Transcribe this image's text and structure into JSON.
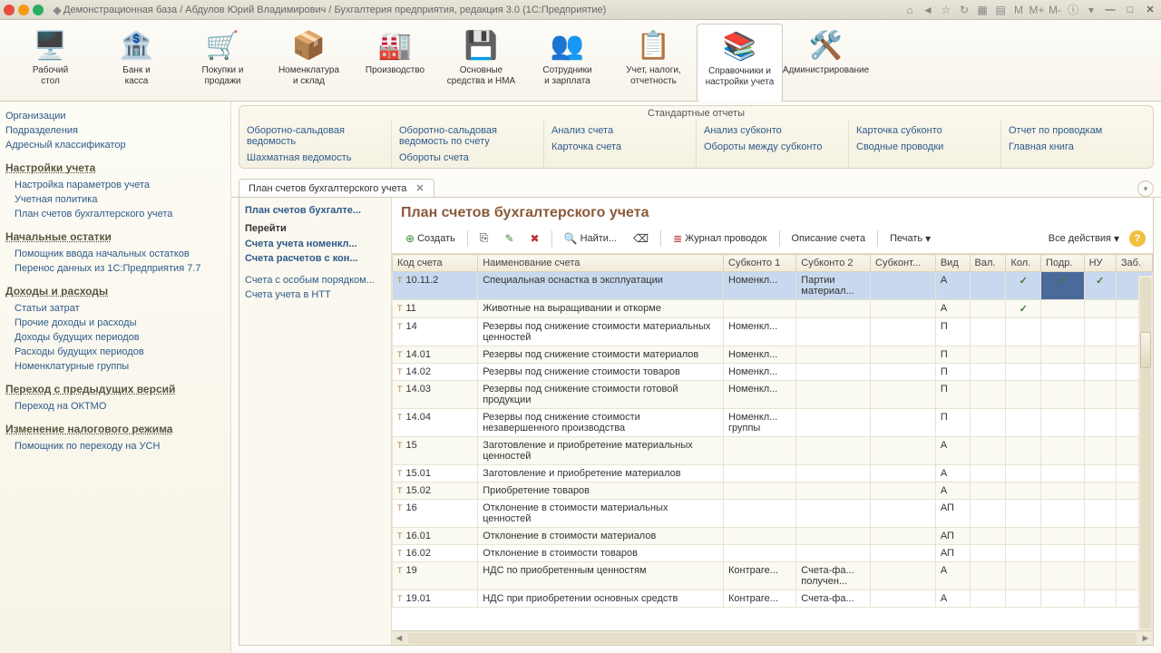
{
  "titlebar": {
    "text": "Демонстрационная база / Абдулов Юрий Владимирович / Бухгалтерия предприятия, редакция 3.0  (1С:Предприятие)",
    "m": "M",
    "mplus": "M+",
    "mminus": "M-"
  },
  "toolbar": [
    {
      "label": "Рабочий\nстол"
    },
    {
      "label": "Банк и\nкасса"
    },
    {
      "label": "Покупки и\nпродажи"
    },
    {
      "label": "Номенклатура\nи склад"
    },
    {
      "label": "Производство"
    },
    {
      "label": "Основные\nсредства и НМА"
    },
    {
      "label": "Сотрудники\nи зарплата"
    },
    {
      "label": "Учет, налоги,\nотчетность"
    },
    {
      "label": "Справочники и\nнастройки учета"
    },
    {
      "label": "Администрирование"
    }
  ],
  "sidebar": {
    "top": [
      "Организации",
      "Подразделения",
      "Адресный классификатор"
    ],
    "groups": [
      {
        "title": "Настройки учета",
        "items": [
          "Настройка параметров учета",
          "Учетная политика",
          "План счетов бухгалтерского учета"
        ]
      },
      {
        "title": "Начальные остатки",
        "items": [
          "Помощник ввода начальных остатков",
          "Перенос данных из 1С:Предприятия 7.7"
        ]
      },
      {
        "title": "Доходы и расходы",
        "items": [
          "Статьи затрат",
          "Прочие доходы и расходы",
          "Доходы будущих периодов",
          "Расходы будущих периодов",
          "Номенклатурные группы"
        ]
      },
      {
        "title": "Переход с предыдущих версий",
        "items": [
          "Переход на ОКТМО"
        ]
      },
      {
        "title": "Изменение налогового режима",
        "items": [
          "Помощник по переходу на УСН"
        ]
      }
    ]
  },
  "reports": {
    "title": "Стандартные отчеты",
    "cols": [
      [
        "Оборотно-сальдовая ведомость",
        "Шахматная ведомость"
      ],
      [
        "Оборотно-сальдовая ведомость по счету",
        "Обороты счета"
      ],
      [
        "Анализ счета",
        "Карточка счета"
      ],
      [
        "Анализ субконто",
        "Обороты между субконто"
      ],
      [
        "Карточка субконто",
        "Сводные проводки"
      ],
      [
        "Отчет по проводкам",
        "Главная книга"
      ]
    ]
  },
  "tab": {
    "label": "План счетов бухгалтерского учета"
  },
  "sub_sidebar": {
    "current": "План счетов бухгалте...",
    "go_title": "Перейти",
    "go_items": [
      "Счета учета номенкл...",
      "Счета расчетов с кон..."
    ],
    "other": [
      "Счета с особым порядком...",
      "Счета учета в НТТ"
    ]
  },
  "page": {
    "title": "План счетов бухгалтерского учета"
  },
  "ctoolbar": {
    "create": "Создать",
    "find": "Найти...",
    "journal": "Журнал проводок",
    "desc": "Описание счета",
    "print": "Печать",
    "all_actions": "Все действия"
  },
  "columns": [
    "Код счета",
    "Наименование счета",
    "Субконто 1",
    "Субконто 2",
    "Субконт...",
    "Вид",
    "Вал.",
    "Кол.",
    "Подр.",
    "НУ",
    "Заб."
  ],
  "rows": [
    {
      "code": "10.11.2",
      "name": "Специальная оснастка в эксплуатации",
      "s1": "Номенкл...",
      "s2": "Партии материал...",
      "s3": "",
      "vid": "А",
      "val": "",
      "kol": "✓",
      "podr": "✓",
      "nu": "✓",
      "zab": "",
      "sel": true
    },
    {
      "code": "11",
      "name": "Животные на выращивании и откорме",
      "s1": "",
      "s2": "",
      "s3": "",
      "vid": "А",
      "val": "",
      "kol": "✓",
      "podr": "",
      "nu": "",
      "zab": ""
    },
    {
      "code": "14",
      "name": "Резервы под снижение стоимости материальных ценностей",
      "s1": "Номенкл...",
      "s2": "",
      "s3": "",
      "vid": "П",
      "val": "",
      "kol": "",
      "podr": "",
      "nu": "",
      "zab": ""
    },
    {
      "code": "14.01",
      "name": "Резервы под снижение стоимости материалов",
      "s1": "Номенкл...",
      "s2": "",
      "s3": "",
      "vid": "П",
      "val": "",
      "kol": "",
      "podr": "",
      "nu": "",
      "zab": ""
    },
    {
      "code": "14.02",
      "name": "Резервы под снижение стоимости товаров",
      "s1": "Номенкл...",
      "s2": "",
      "s3": "",
      "vid": "П",
      "val": "",
      "kol": "",
      "podr": "",
      "nu": "",
      "zab": ""
    },
    {
      "code": "14.03",
      "name": "Резервы под снижение стоимости готовой продукции",
      "s1": "Номенкл...",
      "s2": "",
      "s3": "",
      "vid": "П",
      "val": "",
      "kol": "",
      "podr": "",
      "nu": "",
      "zab": ""
    },
    {
      "code": "14.04",
      "name": "Резервы под снижение стоимости незавершенного производства",
      "s1": "Номенкл... группы",
      "s2": "",
      "s3": "",
      "vid": "П",
      "val": "",
      "kol": "",
      "podr": "",
      "nu": "",
      "zab": ""
    },
    {
      "code": "15",
      "name": "Заготовление и приобретение материальных ценностей",
      "s1": "",
      "s2": "",
      "s3": "",
      "vid": "А",
      "val": "",
      "kol": "",
      "podr": "",
      "nu": "",
      "zab": ""
    },
    {
      "code": "15.01",
      "name": "Заготовление и приобретение материалов",
      "s1": "",
      "s2": "",
      "s3": "",
      "vid": "А",
      "val": "",
      "kol": "",
      "podr": "",
      "nu": "",
      "zab": ""
    },
    {
      "code": "15.02",
      "name": "Приобретение товаров",
      "s1": "",
      "s2": "",
      "s3": "",
      "vid": "А",
      "val": "",
      "kol": "",
      "podr": "",
      "nu": "",
      "zab": ""
    },
    {
      "code": "16",
      "name": "Отклонение в стоимости материальных ценностей",
      "s1": "",
      "s2": "",
      "s3": "",
      "vid": "АП",
      "val": "",
      "kol": "",
      "podr": "",
      "nu": "",
      "zab": ""
    },
    {
      "code": "16.01",
      "name": "Отклонение в стоимости материалов",
      "s1": "",
      "s2": "",
      "s3": "",
      "vid": "АП",
      "val": "",
      "kol": "",
      "podr": "",
      "nu": "",
      "zab": ""
    },
    {
      "code": "16.02",
      "name": "Отклонение в стоимости товаров",
      "s1": "",
      "s2": "",
      "s3": "",
      "vid": "АП",
      "val": "",
      "kol": "",
      "podr": "",
      "nu": "",
      "zab": ""
    },
    {
      "code": "19",
      "name": "НДС по приобретенным ценностям",
      "s1": "Контраге...",
      "s2": "Счета-фа... получен...",
      "s3": "",
      "vid": "А",
      "val": "",
      "kol": "",
      "podr": "",
      "nu": "",
      "zab": ""
    },
    {
      "code": "19.01",
      "name": "НДС при приобретении основных средств",
      "s1": "Контраге...",
      "s2": "Счета-фа...",
      "s3": "",
      "vid": "А",
      "val": "",
      "kol": "",
      "podr": "",
      "nu": "",
      "zab": ""
    }
  ]
}
